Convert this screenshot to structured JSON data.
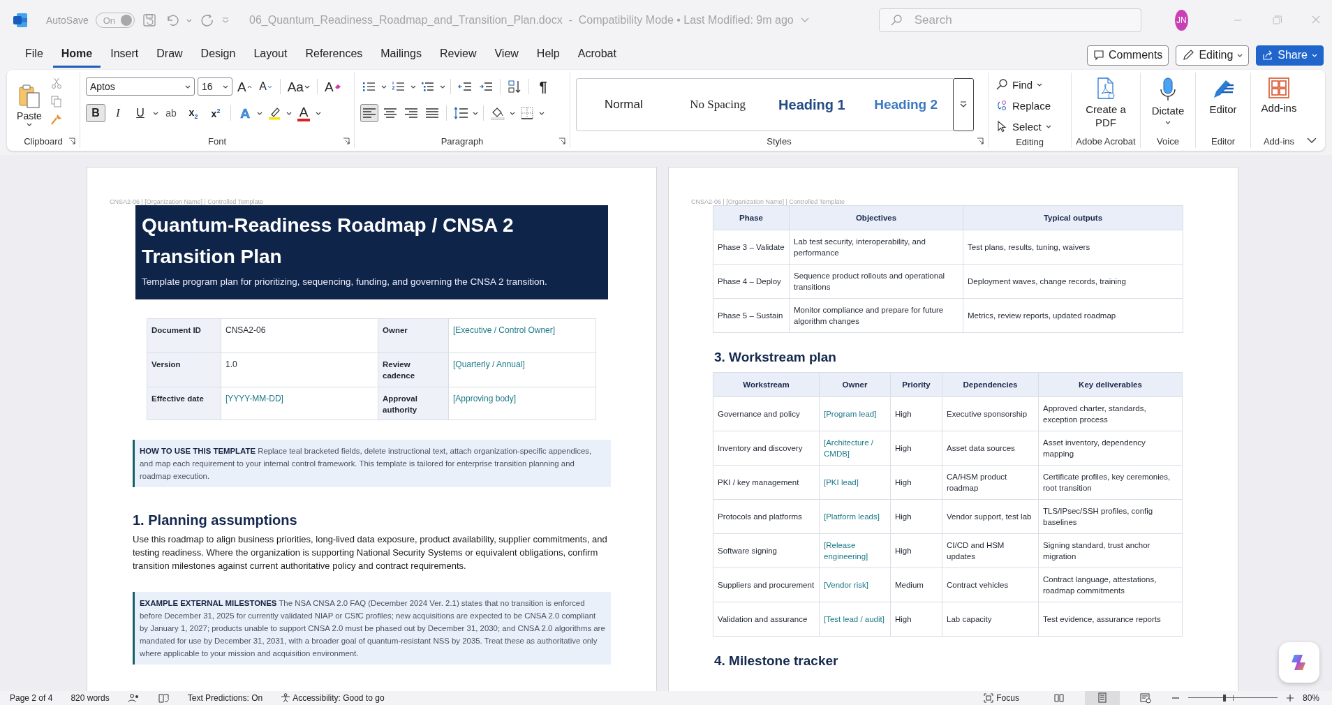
{
  "titlebar": {
    "autosave_label": "AutoSave",
    "autosave_toggle": "On",
    "title": "06_Quantum_Readiness_Roadmap_and_Transition_Plan.docx  -  Compatibility Mode • Last Modified: 9m ago",
    "search_placeholder": "Search",
    "user_initials": "JN"
  },
  "menu_tabs": [
    {
      "label": "File",
      "selected": false
    },
    {
      "label": "Home",
      "selected": true
    },
    {
      "label": "Insert",
      "selected": false
    },
    {
      "label": "Draw",
      "selected": false
    },
    {
      "label": "Design",
      "selected": false
    },
    {
      "label": "Layout",
      "selected": false
    },
    {
      "label": "References",
      "selected": false
    },
    {
      "label": "Mailings",
      "selected": false
    },
    {
      "label": "Review",
      "selected": false
    },
    {
      "label": "View",
      "selected": false
    },
    {
      "label": "Help",
      "selected": false
    },
    {
      "label": "Acrobat",
      "selected": false
    }
  ],
  "header_buttons": [
    {
      "kind": "comments",
      "label": "Comments"
    },
    {
      "kind": "editing",
      "label": "Editing"
    },
    {
      "kind": "share",
      "label": "Share"
    }
  ],
  "ribbon": {
    "clipboard": {
      "paste": "Paste",
      "label": "Clipboard"
    },
    "font": {
      "font_name": "Aptos",
      "font_size": "16",
      "tools": [
        {
          "kind": "grow",
          "text": "A"
        },
        {
          "kind": "shrink",
          "text": "A"
        },
        {
          "kind": "case",
          "text": "Aa"
        },
        {
          "kind": "clear",
          "text": "A"
        }
      ],
      "format_buttons": [
        {
          "text": "B",
          "selected": true
        },
        {
          "text": "I",
          "selected": false
        },
        {
          "text": "U",
          "selected": false
        },
        {
          "text": "ab",
          "selected": false
        },
        {
          "text": "x$_{2}$",
          "selected": false
        },
        {
          "text": "x$^{2}$",
          "selected": false
        }
      ],
      "color_buttons": [
        {
          "kind": "effects",
          "text": "A"
        },
        {
          "kind": "highlight"
        },
        {
          "kind": "color",
          "text": "A"
        }
      ],
      "label": "Font"
    },
    "paragraph": {
      "pilcrow": "¶",
      "alignment": [
        {
          "selected": true
        },
        {
          "selected": false
        },
        {
          "selected": false
        },
        {
          "selected": false
        }
      ],
      "label": "Paragraph"
    },
    "styles": {
      "items": [
        {
          "kind": "normal",
          "label": "Normal"
        },
        {
          "kind": "no_spacing",
          "label": "No Spacing"
        },
        {
          "kind": "heading1",
          "label": "Heading 1"
        },
        {
          "kind": "heading2",
          "label": "Heading 2"
        }
      ],
      "label": "Styles"
    },
    "editing": {
      "items": [
        {
          "kind": "find",
          "label": "Find"
        },
        {
          "kind": "replace",
          "label": "Replace"
        },
        {
          "kind": "select",
          "label": "Select"
        }
      ],
      "label": "Editing"
    },
    "big_groups": [
      {
        "kind": "pdf",
        "button": "Create a PDF",
        "label": "Adobe Acrobat"
      },
      {
        "kind": "dictate",
        "button": "Dictate",
        "label": "Voice"
      },
      {
        "kind": "editor",
        "button": "Editor",
        "label": "Editor"
      },
      {
        "kind": "addins",
        "button": "Add-ins",
        "label": "Add-ins"
      }
    ]
  },
  "pages": [
    {
      "header": "CNSA2-06 | [Organization Name] | Controlled Template",
      "blocks": [
        {
          "kind": "banner",
          "title": "Quantum-Readiness Roadmap / CNSA 2 Transition Plan",
          "subtitle": "Template program plan for prioritizing, sequencing, funding, and governing the CNSA 2 transition."
        },
        {
          "kind": "meta_table",
          "rows": [
            [
              {
                "text": "Document ID",
                "placeholder": false
              },
              {
                "text": "CNSA2-06",
                "placeholder": false
              },
              {
                "text": "Owner",
                "placeholder": false
              },
              {
                "text": "[Executive / Control Owner]",
                "placeholder": true
              }
            ],
            [
              {
                "text": "Version",
                "placeholder": false
              },
              {
                "text": "1.0",
                "placeholder": false
              },
              {
                "text": "Review cadence",
                "placeholder": false
              },
              {
                "text": "[Quarterly / Annual]",
                "placeholder": true
              }
            ],
            [
              {
                "text": "Effective date",
                "placeholder": false
              },
              {
                "text": "[YYYY-MM-DD]",
                "placeholder": true
              },
              {
                "text": "Approval authority",
                "placeholder": false
              },
              {
                "text": "[Approving body]",
                "placeholder": true
              }
            ]
          ]
        },
        {
          "kind": "callout",
          "text": "**HOW TO USE THIS TEMPLATE** Replace teal bracketed fields, delete instructional text, attach organization-specific appendices, and map each requirement to your internal control framework. This template is tailored for enterprise transition planning and roadmap execution."
        },
        {
          "kind": "heading",
          "text": "1. Planning assumptions"
        },
        {
          "kind": "paragraph",
          "text": "Use this roadmap to align business priorities, long-lived data exposure, product availability, supplier commitments, and testing readiness. Where the organization is supporting National Security Systems or equivalent obligations, confirm transition milestones against current authoritative policy and contract requirements."
        },
        {
          "kind": "callout",
          "text": "**EXAMPLE EXTERNAL MILESTONES** The NSA CNSA 2.0 FAQ (December 2024 Ver. 2.1) states that no transition is enforced before December 31, 2025 for currently validated NIAP or CSfC profiles; new acquisitions are expected to be CNSA 2.0 compliant by January 1, 2027; products unable to support CNSA 2.0 must be phased out by December 31, 2030; and CNSA 2.0 algorithms are mandated for use by December 31, 2031, with a broader goal of quantum-resistant NSS by 2035. Treat these as authoritative only where applicable to your mission and acquisition environment."
        }
      ]
    },
    {
      "header": "CNSA2-06 | [Organization Name] | Controlled Template",
      "blocks": [
        {
          "kind": "table",
          "columns": [
            "Phase",
            "Objectives",
            "Typical outputs"
          ],
          "rows": [
            [
              {
                "text": "Phase 3 – Validate",
                "placeholder": false
              },
              {
                "text": "Lab test security, interoperability, and performance",
                "placeholder": false
              },
              {
                "text": "Test plans, results, tuning, waivers",
                "placeholder": false
              }
            ],
            [
              {
                "text": "Phase 4 – Deploy",
                "placeholder": false
              },
              {
                "text": "Sequence product rollouts and operational transitions",
                "placeholder": false
              },
              {
                "text": "Deployment waves, change records, training",
                "placeholder": false
              }
            ],
            [
              {
                "text": "Phase 5 – Sustain",
                "placeholder": false
              },
              {
                "text": "Monitor compliance and prepare for future algorithm changes",
                "placeholder": false
              },
              {
                "text": "Metrics, review reports, updated roadmap",
                "placeholder": false
              }
            ]
          ]
        },
        {
          "kind": "heading",
          "text": "3. Workstream plan"
        },
        {
          "kind": "table",
          "columns": [
            "Workstream",
            "Owner",
            "Priority",
            "Dependencies",
            "Key deliverables"
          ],
          "rows": [
            [
              {
                "text": "Governance and policy",
                "placeholder": false
              },
              {
                "text": "[Program lead]",
                "placeholder": true
              },
              {
                "text": "High",
                "placeholder": false
              },
              {
                "text": "Executive sponsorship",
                "placeholder": false
              },
              {
                "text": "Approved charter, standards, exception process",
                "placeholder": false
              }
            ],
            [
              {
                "text": "Inventory and discovery",
                "placeholder": false
              },
              {
                "text": "[Architecture / CMDB]",
                "placeholder": true
              },
              {
                "text": "High",
                "placeholder": false
              },
              {
                "text": "Asset data sources",
                "placeholder": false
              },
              {
                "text": "Asset inventory, dependency mapping",
                "placeholder": false
              }
            ],
            [
              {
                "text": "PKI / key management",
                "placeholder": false
              },
              {
                "text": "[PKI lead]",
                "placeholder": true
              },
              {
                "text": "High",
                "placeholder": false
              },
              {
                "text": "CA/HSM product roadmap",
                "placeholder": false
              },
              {
                "text": "Certificate profiles, key ceremonies, root transition",
                "placeholder": false
              }
            ],
            [
              {
                "text": "Protocols and platforms",
                "placeholder": false
              },
              {
                "text": "[Platform leads]",
                "placeholder": true
              },
              {
                "text": "High",
                "placeholder": false
              },
              {
                "text": "Vendor support, test lab",
                "placeholder": false
              },
              {
                "text": "TLS/IPsec/SSH profiles, config baselines",
                "placeholder": false
              }
            ],
            [
              {
                "text": "Software signing",
                "placeholder": false
              },
              {
                "text": "[Release engineering]",
                "placeholder": true
              },
              {
                "text": "High",
                "placeholder": false
              },
              {
                "text": "CI/CD and HSM updates",
                "placeholder": false
              },
              {
                "text": "Signing standard, trust anchor migration",
                "placeholder": false
              }
            ],
            [
              {
                "text": "Suppliers and procurement",
                "placeholder": false
              },
              {
                "text": "[Vendor risk]",
                "placeholder": true
              },
              {
                "text": "Medium",
                "placeholder": false
              },
              {
                "text": "Contract vehicles",
                "placeholder": false
              },
              {
                "text": "Contract language, attestations, roadmap commitments",
                "placeholder": false
              }
            ],
            [
              {
                "text": "Validation and assurance",
                "placeholder": false
              },
              {
                "text": "[Test lead / audit]",
                "placeholder": true
              },
              {
                "text": "High",
                "placeholder": false
              },
              {
                "text": "Lab capacity",
                "placeholder": false
              },
              {
                "text": "Test evidence, assurance reports",
                "placeholder": false
              }
            ]
          ]
        },
        {
          "kind": "heading",
          "text": "4. Milestone tracker"
        }
      ]
    }
  ],
  "status_bar": {
    "page": "Page 2 of 4",
    "words": "820 words",
    "predictions": "Text Predictions: On",
    "accessibility": "Accessibility: Good to go",
    "focus": "Focus",
    "views": [
      {
        "selected": false
      },
      {
        "selected": true
      },
      {
        "selected": false
      }
    ],
    "zoom": {
      "level": 0.41,
      "reading": "80%"
    }
  }
}
